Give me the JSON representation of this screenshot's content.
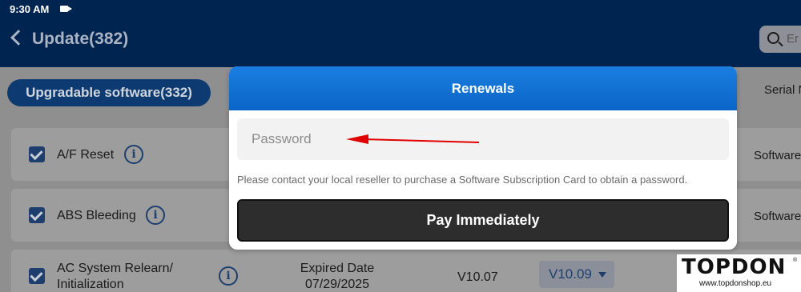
{
  "status": {
    "time": "9:30 AM",
    "camera_icon": "video-camera-icon"
  },
  "header": {
    "title": "Update(382)",
    "search_placeholder": "Er"
  },
  "tabs": {
    "upgradable": "Upgradable software(332)",
    "serial": "Serial N"
  },
  "rows": [
    {
      "label": "A/F Reset",
      "right": "Software"
    },
    {
      "label": "ABS Bleeding",
      "right": "Software"
    },
    {
      "label_line1": "AC System Relearn/",
      "label_line2": "Initialization",
      "expired_line1": "Expired Date",
      "expired_line2": "07/29/2025",
      "version": "V10.07",
      "select_value": "V10.09"
    }
  ],
  "modal": {
    "title": "Renewals",
    "password_placeholder": "Password",
    "hint": "Please contact your local reseller to purchase a Software Subscription Card to obtain a password.",
    "pay_button": "Pay Immediately"
  },
  "watermark": {
    "brand": "TOPDON",
    "reg": "®",
    "url": "www.topdonshop.eu"
  },
  "colors": {
    "header_bg": "#002450",
    "modal_header": "#1170d5",
    "button_dark": "#2d2d2d",
    "arrow_red": "#e00000"
  }
}
